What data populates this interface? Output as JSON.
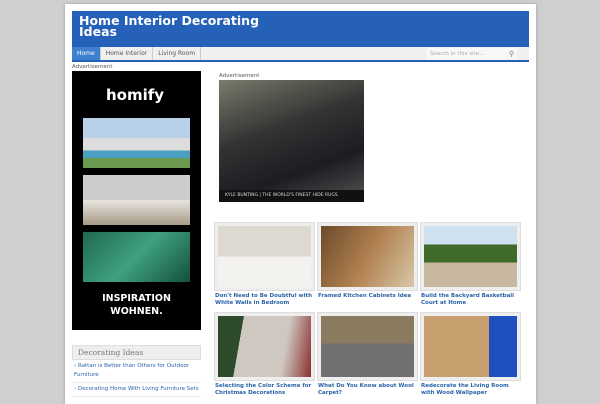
{
  "header": {
    "title": "Home Interior Decorating Ideas"
  },
  "nav": {
    "items": [
      {
        "label": "Home",
        "active": true
      },
      {
        "label": "Home Interior"
      },
      {
        "label": "Living Room"
      }
    ],
    "search_placeholder": "Search in this site..."
  },
  "ads": {
    "label": "Advertisement",
    "left": {
      "logo": "homify",
      "tagline_1": "INSPIRATION",
      "tagline_2": "WOHNEN."
    },
    "right": {
      "caption": "KYLE BUNTING | THE WORLD'S FINEST HIDE RUGS"
    }
  },
  "posts": [
    {
      "title": "Don't Need to Be Doubtful with White Walls in Bedroom"
    },
    {
      "title": "Framed Kitchen Cabinets Idea"
    },
    {
      "title": "Build the Backyard Basketball Court at Home"
    },
    {
      "title": "Selecting the Color Scheme for Christmas Decorations"
    },
    {
      "title": "What Do You Know about Wool Carpet?"
    },
    {
      "title": "Redecorate the Living Room with Wood Wallpaper"
    }
  ],
  "sidebar": {
    "title": "Decorating Ideas",
    "items": [
      "Rattan is Better than Others for Outdoor Furniture",
      "Decorating Home With Living Furniture Sets"
    ]
  }
}
